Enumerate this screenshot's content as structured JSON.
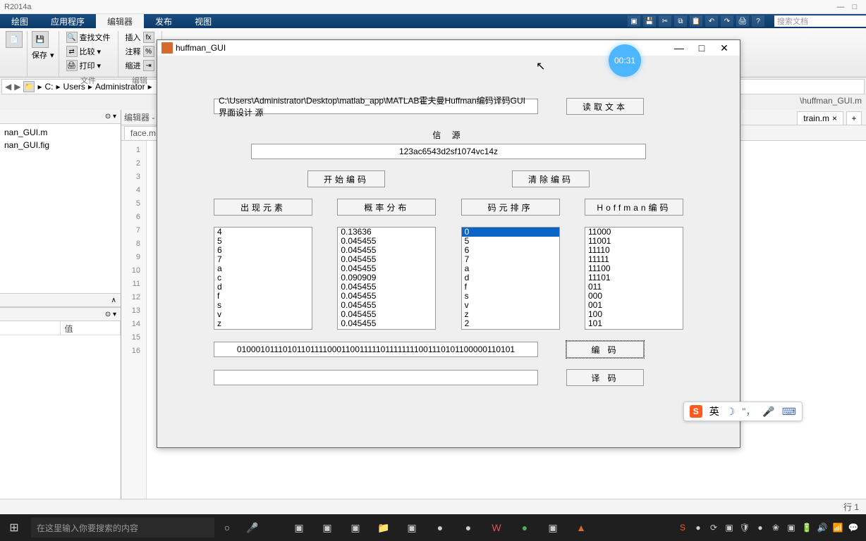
{
  "titlebar": {
    "title": "R2014a"
  },
  "ribbon": {
    "tabs": [
      "绘图",
      "应用程序",
      "编辑器",
      "发布",
      "视图"
    ],
    "active": 2,
    "search_placeholder": "搜索文档"
  },
  "toolbar": {
    "find_files": "查找文件",
    "compare": "比较",
    "print": "打印",
    "insert": "插入",
    "comment": "注释",
    "indent": "缩进",
    "save": "保存",
    "group_file": "文件",
    "group_edit": "编辑"
  },
  "path": {
    "segs": [
      "C:",
      "Users",
      "Administrator"
    ]
  },
  "files": {
    "items": [
      "nan_GUI.m",
      "nan_GUI.fig"
    ]
  },
  "workspace": {
    "col_value": "值"
  },
  "editor": {
    "header": "编辑器 -",
    "tab1": "face.m",
    "lines": [
      "1",
      "2",
      "3",
      "4",
      "5",
      "6",
      "7",
      "8",
      "9",
      "10",
      "11",
      "12",
      "13",
      "14",
      "15",
      "16"
    ],
    "right_tab1": "\\huffman_GUI.m",
    "right_tab2": "train.m"
  },
  "gui": {
    "title": "huffman_GUI",
    "timer": "00:31",
    "path_value": "C:\\Users\\Administrator\\Desktop\\matlab_app\\MATLAB霍夫曼Huffman编码译码GUI界面设计 源",
    "btn_read": "读取文本",
    "label_source": "信  源",
    "source_value": "123ac6543d2sf1074vc14z",
    "btn_start": "开始编码",
    "btn_clear": "清除编码",
    "col_headers": [
      "出现元素",
      "概率分布",
      "码元排序",
      "Hoffman编码"
    ],
    "list1": [
      "4",
      "5",
      "6",
      "7",
      "a",
      "c",
      "d",
      "f",
      "s",
      "v",
      "z"
    ],
    "list2": [
      "0.13636",
      "0.045455",
      "0.045455",
      "0.045455",
      "0.045455",
      "0.090909",
      "0.045455",
      "0.045455",
      "0.045455",
      "0.045455",
      "0.045455"
    ],
    "list3": [
      "0",
      "5",
      "6",
      "7",
      "a",
      "d",
      "f",
      "s",
      "v",
      "z",
      "2"
    ],
    "list3_selected": 0,
    "list4": [
      "11000",
      "11001",
      "11110",
      "11111",
      "11100",
      "11101",
      "011",
      "000",
      "001",
      "100",
      "101"
    ],
    "encoded": "01000101110101101111000110011111011111111001110101100000110101",
    "btn_encode": "编    码",
    "btn_decode": "译    码"
  },
  "status": {
    "line": "行",
    "line_no": "1"
  },
  "taskbar": {
    "search_placeholder": "在这里输入你要搜索的内容"
  },
  "ime": {
    "lang": "英"
  }
}
